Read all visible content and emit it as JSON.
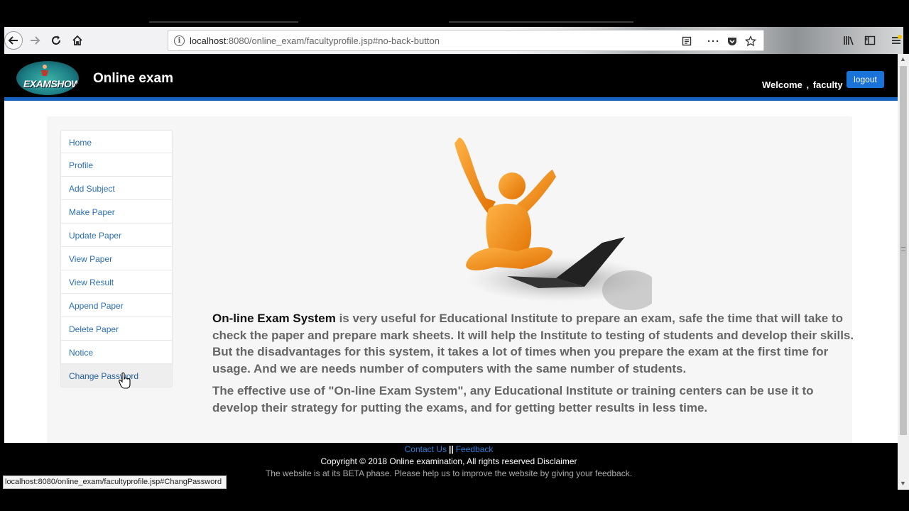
{
  "browser": {
    "url_host": "localhost",
    "url_rest": ":8080/online_exam/facultyprofile.jsp#no-back-button",
    "icons": [
      "back-arrow-icon",
      "forward-arrow-icon",
      "reload-icon",
      "home-icon",
      "page-info-icon",
      "reader-view-icon",
      "more-actions-icon",
      "pocket-icon",
      "bookmark-star-icon",
      "library-icon",
      "sidebar-icon",
      "hamburger-menu-icon"
    ],
    "status_url": "localhost:8080/online_exam/facultyprofile.jsp#ChangPassword"
  },
  "header": {
    "logo_text": "EXAMSHOW",
    "title": "Online exam",
    "welcome_label": "Welcome",
    "welcome_sep": ",",
    "welcome_user": "faculty",
    "logout_label": "logout",
    "accent_color": "#1565c0"
  },
  "sidebar": {
    "items": [
      {
        "label": "Home"
      },
      {
        "label": "Profile"
      },
      {
        "label": "Add Subject"
      },
      {
        "label": "Make Paper"
      },
      {
        "label": "Update Paper"
      },
      {
        "label": "View Paper"
      },
      {
        "label": "View Result"
      },
      {
        "label": "Append Paper"
      },
      {
        "label": "Delete Paper"
      },
      {
        "label": "Notice"
      },
      {
        "label": "Change Password"
      }
    ],
    "hovered_item": "Change Password"
  },
  "main": {
    "lead": "On-line Exam System",
    "paragraph1_rest": " is very useful for Educational Institute to prepare an exam, safe the time that will take to check the paper and prepare mark sheets. It will help the Institute to testing of students and develop their skills. But the disadvantages for this system, it takes a lot of times when you prepare the exam at the first time for usage. And we are needs number of computers with the same number of students.",
    "paragraph2": "The effective use of \"On-line Exam System\", any Educational Institute or training centers can be use it to develop their strategy for putting the exams, and for getting better results in less time."
  },
  "footer": {
    "contact_label": "Contact Us",
    "separator": "||",
    "feedback_label": "Feedback",
    "copyright": "Copyright © 2018 Online examination, All rights reserved Disclaimer",
    "beta_notice": "The website is at its BETA phase. Please help us to improve the website by giving your feedback."
  }
}
